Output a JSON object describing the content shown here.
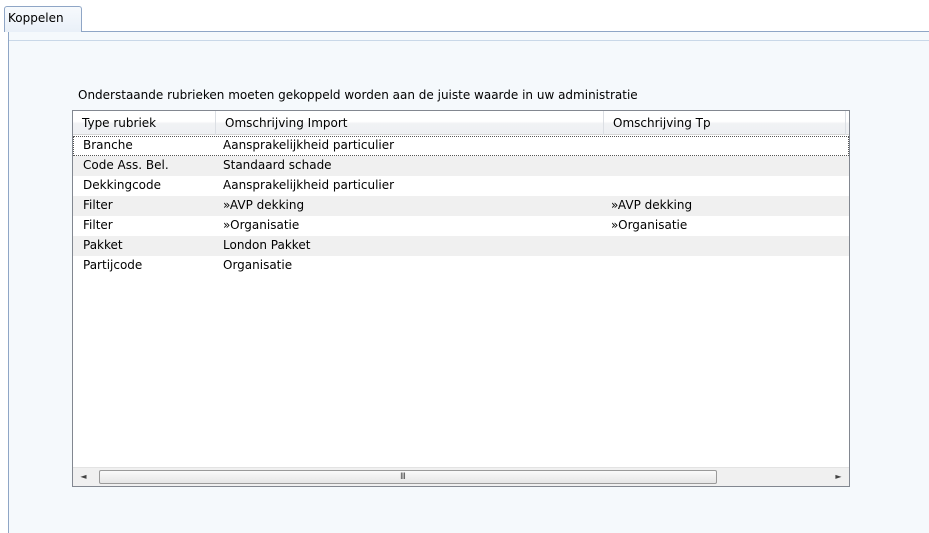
{
  "tabs": [
    {
      "label": "Koppelen"
    }
  ],
  "panel": {
    "description": "Onderstaande rubrieken moeten gekoppeld worden aan de juiste waarde in uw administratie"
  },
  "table": {
    "columns": [
      "Type rubriek",
      "Omschrijving Import",
      "Omschrijving Tp"
    ],
    "rows": [
      [
        "Branche",
        "Aansprakelijkheid particulier",
        ""
      ],
      [
        "Code Ass. Bel.",
        "Standaard schade",
        ""
      ],
      [
        "Dekkingcode",
        "Aansprakelijkheid particulier",
        ""
      ],
      [
        "Filter",
        "»AVP dekking",
        "»AVP dekking"
      ],
      [
        "Filter",
        "»Organisatie",
        "»Organisatie"
      ],
      [
        "Pakket",
        "London Pakket",
        ""
      ],
      [
        "Partijcode",
        "Organisatie",
        ""
      ]
    ]
  },
  "scrollbar": {
    "left_icon": "◄",
    "right_icon": "►",
    "grip_icon": "III"
  }
}
